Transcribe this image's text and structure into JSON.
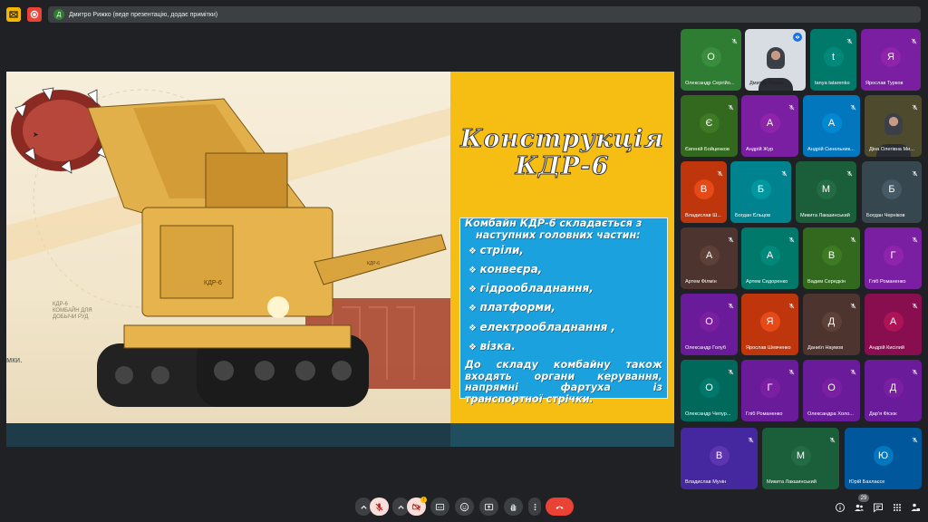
{
  "topbar": {
    "presenter_initial": "Д",
    "presenting_text": "Дмитро Рижко (веде презентацію, додає примітки)"
  },
  "slide": {
    "title_line1": "Конструкція",
    "title_line2": "КДР-6",
    "intro_line1": "Комбайн КДР-6 складається з",
    "intro_line2": "наступних головних частин:",
    "bullets": [
      "стріли,",
      "конвеєра,",
      "гідрообладнання,",
      "платформи,",
      "електрообладнання ,",
      "візка."
    ],
    "closing": "До складу комбайну також входять органи керування, напрямні фартуха із транспортної стрічки.",
    "photo_label": "КДР-6\nКОМБАЙН ДЛЯ\nДОБЫЧИ РУД",
    "photo_left_text": "мки.",
    "machine_badge": "КДР-6",
    "machine_badge2": "КДР-6"
  },
  "participants": [
    {
      "initial": "О",
      "name": "Олександр Сергійо...",
      "color": "#2e7d32",
      "avatar": "#3a8d3f"
    },
    {
      "initial": "",
      "name": "Дмитро Рижко",
      "color": "#d7dde2",
      "avatar": "",
      "photo": true
    },
    {
      "initial": "t",
      "name": "tanya tatarenko",
      "color": "#00796b",
      "avatar": "#00897b"
    },
    {
      "initial": "Я",
      "name": "Ярослав Турков",
      "color": "#7b1fa2",
      "avatar": "#8e24aa"
    },
    {
      "initial": "Є",
      "name": "Євгеній Бойценков",
      "color": "#33691e",
      "avatar": "#3e7a24"
    },
    {
      "initial": "А",
      "name": "Андрій Жур",
      "color": "#7b1fa2",
      "avatar": "#8e24aa"
    },
    {
      "initial": "А",
      "name": "Андрій Синельник...",
      "color": "#0277bd",
      "avatar": "#0288d1"
    },
    {
      "initial": "",
      "name": "Діна Олегівна Ми...",
      "color": "#4e4a2e",
      "avatar": "",
      "photo": true
    },
    {
      "initial": "В",
      "name": "Владислав Ш...",
      "color": "#bf360c",
      "avatar": "#e64a19"
    },
    {
      "initial": "Б",
      "name": "Богдан Єльцов",
      "color": "#00838f",
      "avatar": "#00979f"
    },
    {
      "initial": "М",
      "name": "Микита Лакшинський",
      "color": "#1b5e3a",
      "avatar": "#236b44"
    },
    {
      "initial": "Б",
      "name": "Богдан Черніков",
      "color": "#37474f",
      "avatar": "#455a64"
    },
    {
      "initial": "А",
      "name": "Артем Філмін",
      "color": "#4e342e",
      "avatar": "#5d4037"
    },
    {
      "initial": "А",
      "name": "Артем Сидоренко",
      "color": "#00796b",
      "avatar": "#00897b"
    },
    {
      "initial": "В",
      "name": "Вадим Середкін",
      "color": "#33691e",
      "avatar": "#3e7a24"
    },
    {
      "initial": "Г",
      "name": "Гліб Романенко",
      "color": "#7b1fa2",
      "avatar": "#8e24aa"
    },
    {
      "initial": "О",
      "name": "Олександр Голуб",
      "color": "#6a1b9a",
      "avatar": "#7b1fa2"
    },
    {
      "initial": "Я",
      "name": "Ярослав Шевченко",
      "color": "#bf360c",
      "avatar": "#e64a19"
    },
    {
      "initial": "Д",
      "name": "Даниїл Наумов",
      "color": "#4e342e",
      "avatar": "#5d4037"
    },
    {
      "initial": "А",
      "name": "Андрій Кисілий",
      "color": "#880e4f",
      "avatar": "#ad1457"
    },
    {
      "initial": "О",
      "name": "Олександр Чепур...",
      "color": "#00695c",
      "avatar": "#00796b"
    },
    {
      "initial": "Г",
      "name": "Гліб Романенко",
      "color": "#6a1b9a",
      "avatar": "#7b1fa2"
    },
    {
      "initial": "О",
      "name": "Олександра Холо...",
      "color": "#6a1b9a",
      "avatar": "#7b1fa2"
    },
    {
      "initial": "Д",
      "name": "Дар'я Фісюк",
      "color": "#6a1b9a",
      "avatar": "#7b1fa2"
    },
    {
      "initial": "В",
      "name": "Владислав Мунін",
      "color": "#4527a0",
      "avatar": "#5e35b1"
    },
    {
      "initial": "М",
      "name": "Микита Лакшинський",
      "color": "#1b5e3a",
      "avatar": "#236b44"
    },
    {
      "initial": "Ю",
      "name": "Юрій Бахлаєсе",
      "color": "#01579b",
      "avatar": "#0277bd"
    }
  ],
  "controls": {
    "participant_count": "29",
    "present_badge": "!"
  },
  "colors": {
    "background": "#202124",
    "slide_yellow": "#f6bd12",
    "slide_box": "#1aa1de",
    "leave_red": "#ea4335",
    "muted_pink": "#f9dedc"
  }
}
